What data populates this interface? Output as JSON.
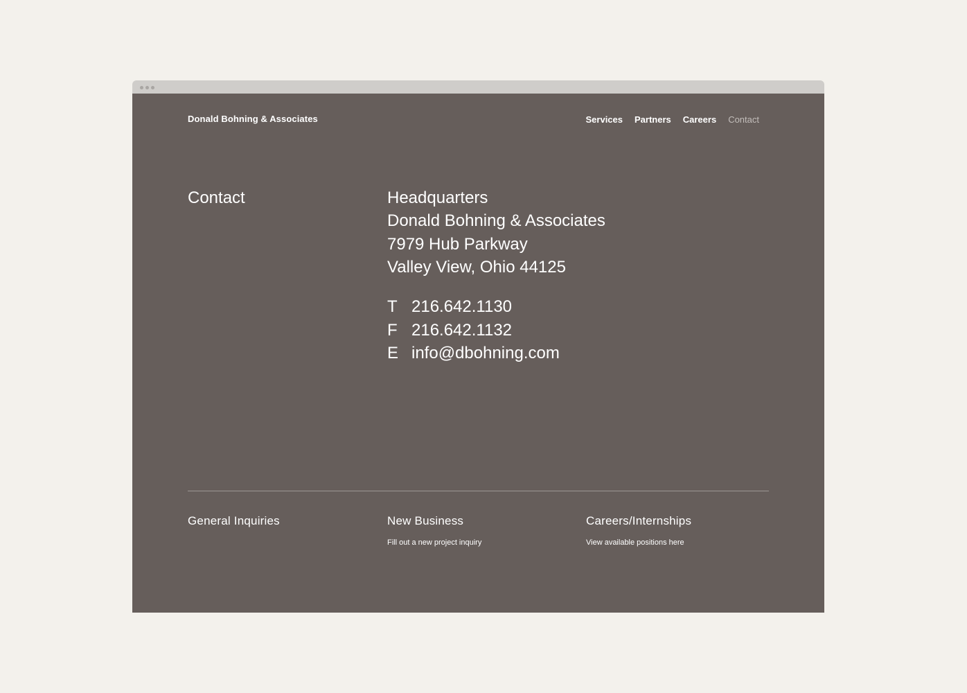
{
  "header": {
    "brand": "Donald Bohning & Associates",
    "nav": [
      {
        "label": "Services"
      },
      {
        "label": "Partners"
      },
      {
        "label": "Careers"
      },
      {
        "label": "Contact"
      }
    ]
  },
  "main": {
    "section_title": "Contact",
    "headquarters": {
      "heading": "Headquarters",
      "company": "Donald Bohning & Associates",
      "street": "7979 Hub Parkway",
      "city": "Valley View, Ohio 44125"
    },
    "contacts": [
      {
        "label": "T",
        "value": "216.642.1130"
      },
      {
        "label": "F",
        "value": "216.642.1132"
      },
      {
        "label": "E",
        "value": "info@dbohning.com"
      }
    ]
  },
  "footer": {
    "columns": [
      {
        "heading": "General Inquiries",
        "link": ""
      },
      {
        "heading": "New Business",
        "link": "Fill out a new project inquiry"
      },
      {
        "heading": "Careers/Internships",
        "link": "View available positions here"
      }
    ]
  }
}
